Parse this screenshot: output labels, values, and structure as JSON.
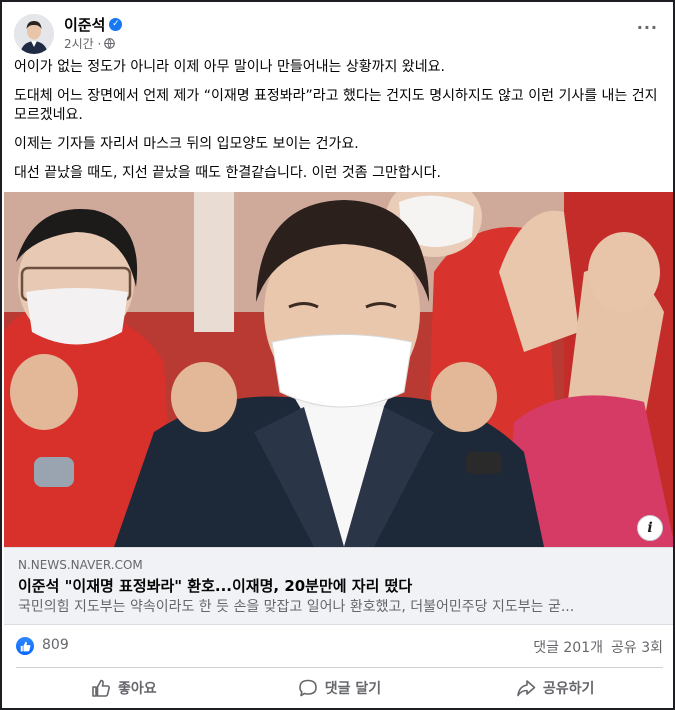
{
  "post": {
    "author": "이준석",
    "time": "2시간 ·",
    "paragraphs": [
      "어이가 없는 정도가 아니라 이제 아무 말이나 만들어내는 상황까지 왔네요.",
      "도대체 어느 장면에서 언제 제가 “이재명 표정봐라”라고 했다는 건지도 명시하지도 않고 이런 기사를 내는 건지 모르겠네요.",
      "이제는 기자들 자리서 마스크 뒤의 입모양도 보이는 건가요.",
      "대선 끝났을 때도, 지선 끝났을 때도 한결같습니다. 이런 것좀 그만합시다."
    ],
    "more_label": "···"
  },
  "link": {
    "domain": "N.NEWS.NAVER.COM",
    "title": "이준석 \"이재명 표정봐라\" 환호...이재명, 20분만에 자리 떴다",
    "description": "국민의힘 지도부는 약속이라도 한 듯 손을 맞잡고 일어나 환호했고, 더불어민주당 지도부는 굳...",
    "info_label": "i"
  },
  "stats": {
    "likes": "809",
    "comments": "댓글 201개",
    "shares": "공유 3회"
  },
  "actions": {
    "like": "좋아요",
    "comment": "댓글 달기",
    "share": "공유하기"
  },
  "colors": {
    "accent": "#1877f2",
    "secondary_text": "#65676b",
    "link_card_bg": "#f0f2f5",
    "photo_red": "#c9332f"
  },
  "icons": [
    "verified-badge-icon",
    "globe-icon",
    "more-options-icon",
    "info-icon",
    "like-reaction-icon",
    "thumbs-up-icon",
    "comment-icon",
    "share-icon"
  ]
}
